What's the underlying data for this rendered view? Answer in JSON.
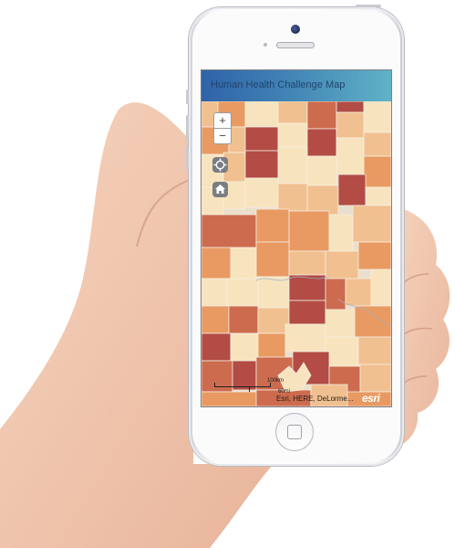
{
  "app": {
    "title": "Human Health Challenge Map"
  },
  "map": {
    "zoom_in_label": "+",
    "zoom_out_label": "−",
    "scale_km": "100km",
    "scale_mi": "60mi",
    "attribution": "Esri, HERE, DeLorme...",
    "logo": "esri",
    "palette": [
      "#f7e4be",
      "#f1c090",
      "#e89a62",
      "#cd6b4e",
      "#b24c45"
    ]
  },
  "icons": [
    "locate-icon",
    "home-icon",
    "zoom-in-icon",
    "zoom-out-icon"
  ]
}
